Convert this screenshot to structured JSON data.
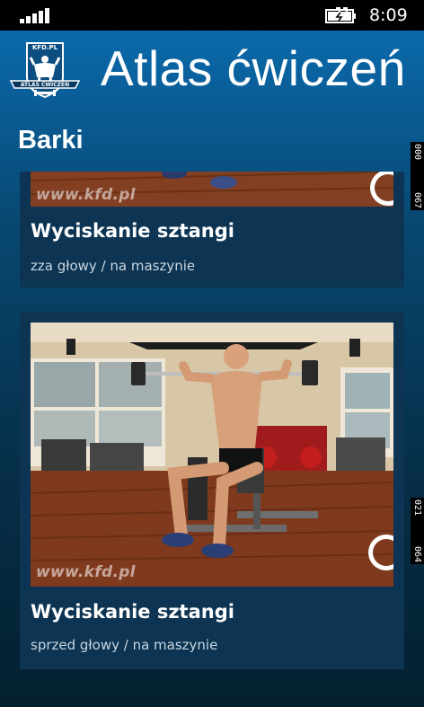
{
  "status_bar": {
    "time": "8:09"
  },
  "header": {
    "app_title": "Atlas ćwiczeń",
    "logo_text_top": "KFD.PL",
    "logo_text_bottom": "ATLAS ĆWICZEŃ"
  },
  "section": {
    "title": "Barki"
  },
  "exercises": [
    {
      "title": "Wyciskanie sztangi",
      "subtitle": "zza głowy / na maszynie",
      "watermark": "www.kfd.pl"
    },
    {
      "title": "Wyciskanie sztangi",
      "subtitle": "sprzed głowy / na maszynie",
      "watermark": "www.kfd.pl"
    }
  ],
  "side_counters": [
    {
      "a": "067",
      "b": "000"
    },
    {
      "a": "064",
      "b": "021"
    }
  ],
  "colors": {
    "accent": "#0b6fb3",
    "card_bg": "#0d3452",
    "floor": "#7a3a1e"
  }
}
